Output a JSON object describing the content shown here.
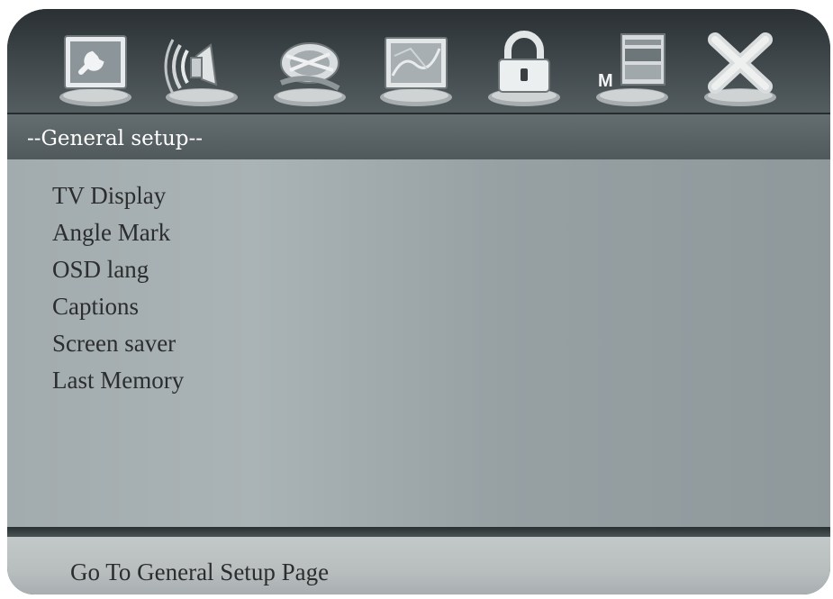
{
  "toolbar": {
    "icons": [
      "general-setup-icon",
      "audio-setup-icon",
      "video-setup-icon",
      "preference-icon",
      "password-lock-icon",
      "media-setup-icon",
      "exit-icon"
    ],
    "media_icon_letter": "M"
  },
  "page": {
    "title": "--General setup--"
  },
  "menu": {
    "items": [
      {
        "label": "TV Display"
      },
      {
        "label": "Angle Mark"
      },
      {
        "label": "OSD lang"
      },
      {
        "label": "Captions"
      },
      {
        "label": "Screen saver"
      },
      {
        "label": "Last Memory"
      }
    ]
  },
  "status": {
    "text": "Go To General Setup Page"
  },
  "colors": {
    "toolbar": "#3d4548",
    "content": "#a2abad",
    "status": "#bcc1c2",
    "accent_red": "#9b2a2a"
  }
}
